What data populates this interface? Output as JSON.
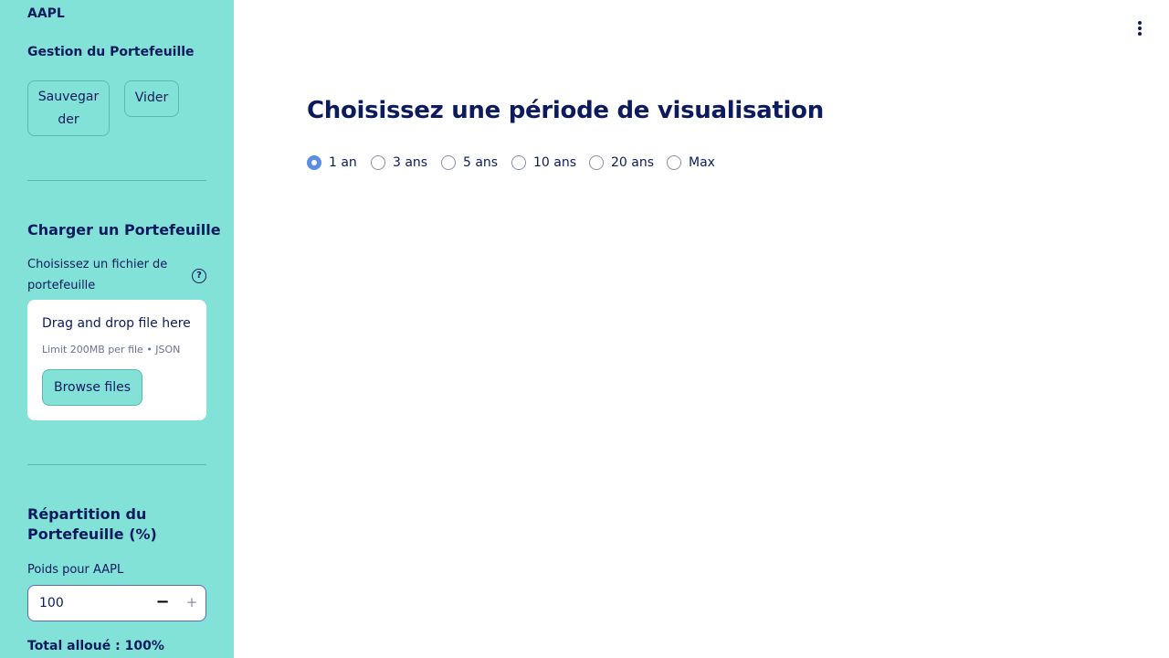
{
  "sidebar": {
    "ticker": "AAPL",
    "portfolio_section_title": "Gestion du Portefeuille",
    "save_button": "Sauvegarder",
    "clear_button": "Vider",
    "load_section_title": "Charger un Portefeuille",
    "file_label": "Choisissez un fichier de portefeuille",
    "dropzone_title": "Drag and drop file here",
    "dropzone_limit": "Limit 200MB per file • JSON",
    "browse_button": "Browse files",
    "allocation_title": "Répartition du Portefeuille (%)",
    "weight_label": "Poids pour AAPL",
    "weight_value": "100",
    "minus_symbol": "−",
    "plus_symbol": "+",
    "total_text": "Total alloué : 100%",
    "help_icon_symbol": "?"
  },
  "main": {
    "title": "Choisissez une période de visualisation",
    "periods": [
      "1 an",
      "3 ans",
      "5 ans",
      "10 ans",
      "20 ans",
      "Max"
    ],
    "selected_period": "1 an"
  },
  "colors": {
    "sidebar_bg": "#83e2d8",
    "text": "#0d1b5e",
    "radio_selected": "#5b8ee6"
  },
  "icons": {
    "menu": "kebab-menu-icon",
    "help": "help-circle-icon"
  }
}
